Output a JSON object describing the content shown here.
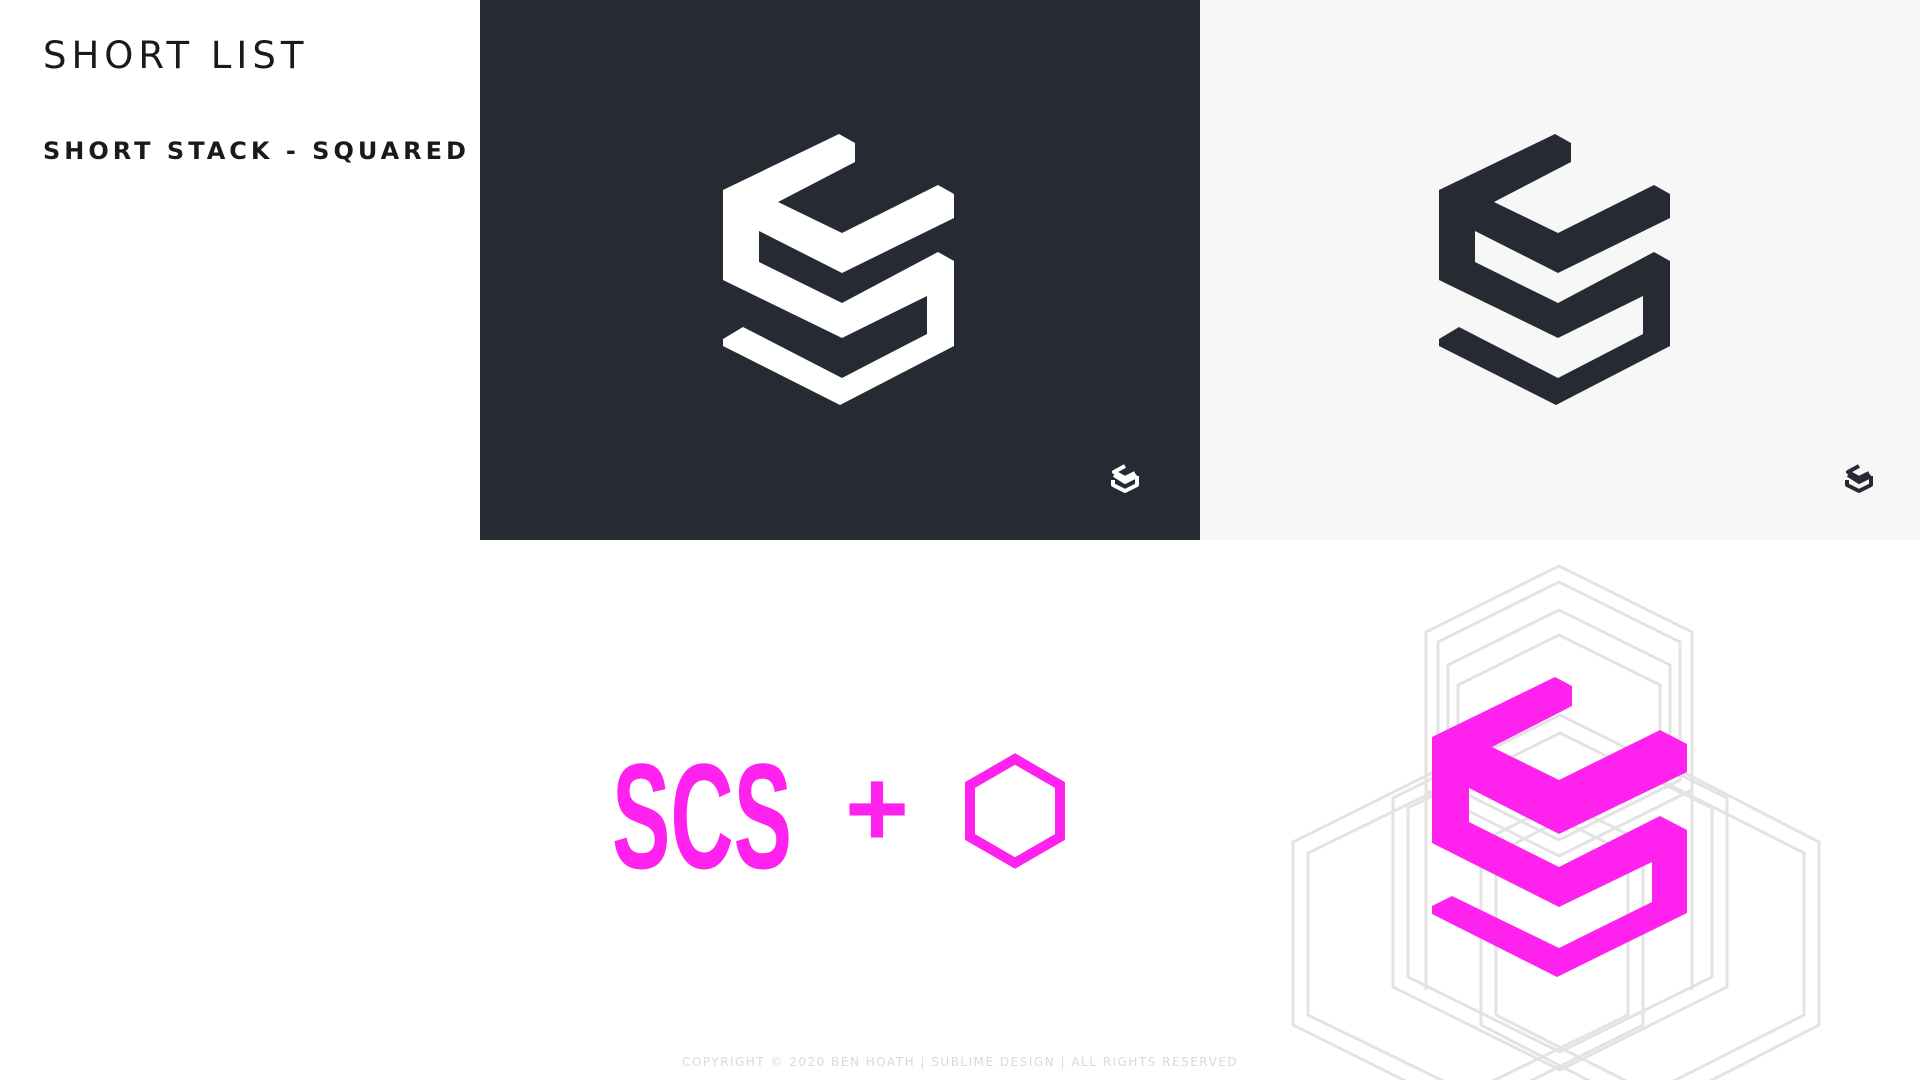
{
  "header": {
    "title": "SHORT LIST",
    "subtitle": "SHORT STACK - SQUARED"
  },
  "concept": {
    "letters": "SCS",
    "operator": "+"
  },
  "footer": {
    "text": "COPYRIGHT © 2020 BEN HOATH | SUBLIME DESIGN | ALL RIGHTS RESERVED"
  },
  "colors": {
    "dark_panel": "#262b33",
    "light_panel": "#f7f7f7",
    "mark_on_dark": "#ffffff",
    "mark_on_light": "#262b33",
    "accent": "#ff22ee",
    "guides": "#e6e6e6"
  },
  "icons": {
    "main_mark": "scs-hexagon-logo-icon",
    "small_mark": "scs-stack-small-icon",
    "hexagon": "hexagon-outline-icon"
  }
}
